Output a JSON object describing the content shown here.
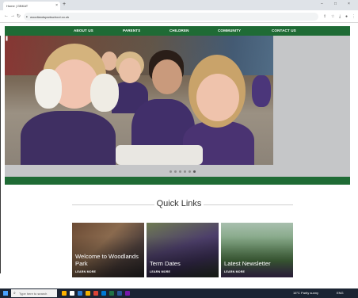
{
  "browser": {
    "tab_title": "Home | GBKAT",
    "tab_close": "×",
    "new_tab": "+",
    "url": "woodlandsparkschool.co.uk",
    "min": "–",
    "max": "□",
    "close": "×"
  },
  "nav": {
    "items": [
      "ABOUT US",
      "PARENTS",
      "CHILDREN",
      "COMMUNITY",
      "CONTACT US"
    ]
  },
  "quick_links": {
    "title": "Quick Links",
    "cards": [
      {
        "title": "Welcome to Woodlands Park",
        "more": "LEARN MORE"
      },
      {
        "title": "Term Dates",
        "more": "LEARN MORE"
      },
      {
        "title": "Latest Newsletter",
        "more": "LEARN MORE"
      }
    ]
  },
  "taskbar": {
    "search_placeholder": "Type here to search",
    "weather": "16°C Partly sunny",
    "lang": "ENG"
  },
  "colors": {
    "brand_green": "#1f6b35"
  }
}
